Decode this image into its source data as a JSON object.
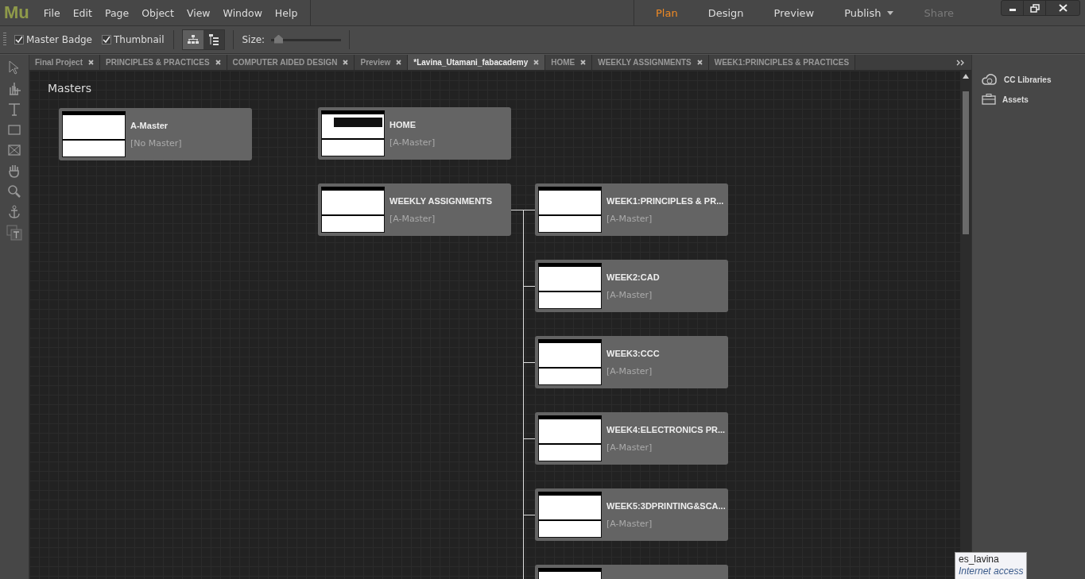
{
  "app_logo": "Mu",
  "menu": [
    "File",
    "Edit",
    "Page",
    "Object",
    "View",
    "Window",
    "Help"
  ],
  "modes": [
    {
      "label": "Plan",
      "selected": true,
      "disabled": false
    },
    {
      "label": "Design",
      "selected": false,
      "disabled": false
    },
    {
      "label": "Preview",
      "selected": false,
      "disabled": false
    },
    {
      "label": "Publish",
      "selected": false,
      "disabled": false,
      "dropdown": true
    },
    {
      "label": "Share",
      "selected": false,
      "disabled": true
    }
  ],
  "toolbar": {
    "options": [
      {
        "label": "Master Badge",
        "checked": true
      },
      {
        "label": "Thumbnail",
        "checked": true
      }
    ],
    "views": [
      {
        "kind": "sitemap",
        "selected": true
      },
      {
        "kind": "list",
        "selected": false
      }
    ],
    "size_label": "Size:",
    "size": {
      "level": 0.1
    }
  },
  "tabs": [
    {
      "label": "Final Project",
      "selected": false
    },
    {
      "label": "PRINCIPLES & PRACTICES",
      "selected": false
    },
    {
      "label": "COMPUTER AIDED DESIGN",
      "selected": false
    },
    {
      "label": "Preview",
      "selected": false
    },
    {
      "label": "*Lavina_Utamani_fabacademy",
      "selected": true
    },
    {
      "label": "HOME",
      "selected": false
    },
    {
      "label": "WEEKLY ASSIGNMENTS",
      "selected": false
    },
    {
      "label": "WEEK1:PRINCIPLES & PRACTICES",
      "selected": false,
      "closable": false
    }
  ],
  "masters": {
    "heading": "Masters",
    "items": [
      {
        "title": "A-Master",
        "master": "[No Master]"
      }
    ]
  },
  "pages": [
    {
      "title": "HOME",
      "master": "[A-Master]",
      "kind": "home"
    },
    {
      "title": "WEEKLY ASSIGNMENTS",
      "master": "[A-Master]",
      "kind": "plain",
      "children": [
        {
          "title": "WEEK1:PRINCIPLES & PR...",
          "master": "[A-Master]",
          "kind": "plain"
        },
        {
          "title": "WEEK2:CAD",
          "master": "[A-Master]",
          "kind": "plain"
        },
        {
          "title": "WEEK3:CCC",
          "master": "[A-Master]",
          "kind": "plain"
        },
        {
          "title": "WEEK4:ELECTRONICS PR...",
          "master": "[A-Master]",
          "kind": "plain"
        },
        {
          "title": "WEEK5:3DPRINTING&SCA...",
          "master": "[A-Master]",
          "kind": "plain"
        },
        {
          "kind": "cut"
        }
      ]
    }
  ],
  "panel": {
    "items": [
      {
        "label": "CC Libraries",
        "kind": "libraries"
      },
      {
        "label": "Assets",
        "kind": "assets"
      }
    ]
  },
  "tooltip": {
    "title": "es_lavina",
    "subtitle": "Internet access"
  }
}
